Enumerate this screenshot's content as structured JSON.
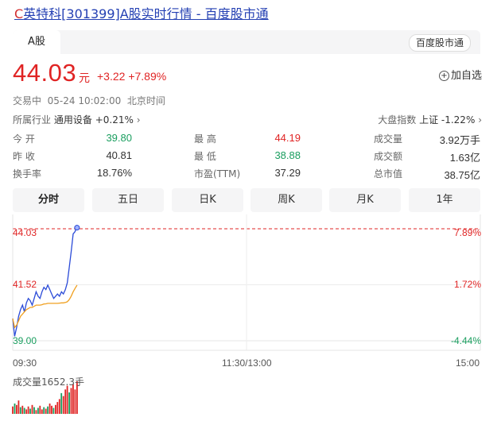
{
  "header": {
    "title_prefix": "C",
    "title_rest": "英特科[301399]A股实时行情 - 百度股市通"
  },
  "tabs": {
    "active": "A股",
    "source_button": "百度股市通"
  },
  "quote": {
    "price": "44.03",
    "unit": "元",
    "change": "+3.22 +7.89%",
    "add_watch": "加自选",
    "status": "交易中  05-24 10:02:00  北京时间",
    "industry_label": "所属行业",
    "industry_value": "通用设备",
    "industry_change": "+0.21%",
    "index_label": "大盘指数",
    "index_value": "上证 -1.22%"
  },
  "stats": {
    "open_label": "今  开",
    "open": "39.80",
    "high_label": "最  高",
    "high": "44.19",
    "volume_label": "成交量",
    "volume": "3.92万手",
    "prev_label": "昨  收",
    "prev": "40.81",
    "low_label": "最  低",
    "low": "38.88",
    "amount_label": "成交额",
    "amount": "1.63亿",
    "turnover_label": "换手率",
    "turnover": "18.76%",
    "pe_label": "市盈(TTM)",
    "pe": "37.29",
    "mcap_label": "总市值",
    "mcap": "38.75亿"
  },
  "periods": [
    "分时",
    "五日",
    "日K",
    "周K",
    "月K",
    "1年"
  ],
  "colors": {
    "up": "#e02424",
    "down": "#1a9e5f",
    "price_line": "#2b4bd8",
    "avg_line": "#f0a020",
    "link": "#2440b3"
  },
  "chart_data": {
    "type": "line",
    "y_left_labels": [
      "44.03",
      "41.52",
      "39.00"
    ],
    "y_right_labels": [
      "7.89%",
      "1.72%",
      "-4.44%"
    ],
    "x_labels": [
      "09:30",
      "11:30/13:00",
      "15:00"
    ],
    "ylim": [
      39.0,
      44.03
    ],
    "volume_label": "成交量1652.3手",
    "series": [
      {
        "values": [
          40.0,
          39.2,
          39.6,
          40.1,
          40.4,
          40.6,
          40.3,
          40.7,
          40.9,
          40.8,
          40.6,
          40.9,
          41.2,
          41.0,
          40.9,
          41.2,
          41.4,
          41.3,
          41.5,
          41.3,
          41.1,
          40.9,
          41.0,
          41.1,
          41.0,
          41.2,
          41.1,
          41.3,
          41.6,
          42.3,
          43.0,
          43.8,
          43.9,
          44.2
        ]
      },
      {
        "values": [
          40.0,
          39.6,
          39.7,
          39.9,
          40.1,
          40.2,
          40.3,
          40.4,
          40.45,
          40.5,
          40.5,
          40.55,
          40.6,
          40.6,
          40.6,
          40.62,
          40.65,
          40.66,
          40.68,
          40.68,
          40.68,
          40.68,
          40.68,
          40.68,
          40.69,
          40.7,
          40.7,
          40.72,
          40.75,
          40.85,
          41.0,
          41.2,
          41.35,
          41.5
        ]
      }
    ],
    "volume_values": [
      10,
      14,
      12,
      18,
      9,
      11,
      8,
      6,
      10,
      7,
      12,
      9,
      5,
      8,
      11,
      6,
      9,
      7,
      10,
      14,
      11,
      8,
      12,
      16,
      20,
      28,
      24,
      33,
      38,
      29,
      35,
      40,
      33,
      44
    ],
    "volume_colors": [
      "up",
      "down",
      "up",
      "up",
      "down",
      "up",
      "down",
      "up",
      "up",
      "down",
      "up",
      "down",
      "up",
      "down",
      "up",
      "up",
      "down",
      "up",
      "down",
      "up",
      "up",
      "down",
      "up",
      "up",
      "up",
      "down",
      "up",
      "up",
      "up",
      "down",
      "up",
      "up",
      "up",
      "up"
    ]
  }
}
